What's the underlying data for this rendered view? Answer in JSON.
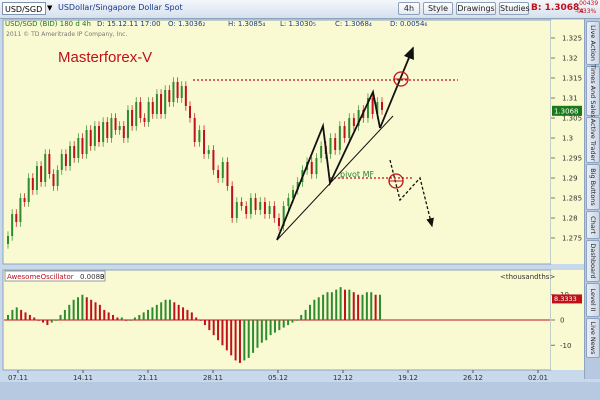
{
  "toolbar": {
    "symbol": "USD/SGD",
    "description": "USDollar/Singapore Dollar Spot",
    "interval": "4h",
    "style_label": "Style",
    "drawings_label": "Drawings",
    "studies_label": "Studies",
    "bid_label": "B: 1.3068",
    "bid_small": "4",
    "change_abs": "-.00439",
    "change_pct": "-0.33%"
  },
  "header": {
    "info_line": "USD/SGD (BID) 180 d 4h",
    "date": "D: 15.12.11 17:00",
    "open": "O: 1.3036₂",
    "high": "H: 1.3085₄",
    "low": "L: 1.3030₅",
    "close": "C: 1.3068₄",
    "change": "D: 0.0054₆",
    "copyright": "2011 © TD Ameritrade IP Company, Inc."
  },
  "annotations": {
    "brand": "Masterforex-V",
    "pivot": "pivot MF"
  },
  "oscillator": {
    "name": "AwesomeOscillator",
    "value": "0.0083",
    "extra": "0",
    "units": "<thousandths>",
    "yticks": [
      "10",
      "0",
      "-10"
    ],
    "current_value_label": "8.3333"
  },
  "right_tabs": [
    "Live Action",
    "Times And Sales",
    "Active Trader",
    "Big Buttons",
    "Chart",
    "Dashboard",
    "Level II",
    "Live News"
  ],
  "colors": {
    "bg_plot": "#fafad2",
    "up": "#2e8b2e",
    "down": "#c0101a",
    "dotted": "#c0101a"
  },
  "chart_data": {
    "type": "candlestick",
    "price": {
      "ylim": [
        1.269,
        1.329
      ],
      "yticks": [
        "1.325",
        "1.32",
        "1.315",
        "1.31",
        "1.305",
        "1.3",
        "1.295",
        "1.29",
        "1.285",
        "1.28",
        "1.275"
      ],
      "last_price_label": "1.3068",
      "resistance": 1.3145,
      "pivot": 1.29,
      "series_close": [
        1.2755,
        1.281,
        1.279,
        1.285,
        1.284,
        1.29,
        1.287,
        1.293,
        1.289,
        1.296,
        1.291,
        1.288,
        1.292,
        1.296,
        1.293,
        1.298,
        1.295,
        1.3,
        1.296,
        1.302,
        1.298,
        1.303,
        1.299,
        1.304,
        1.3,
        1.305,
        1.302,
        1.303,
        1.3,
        1.307,
        1.303,
        1.309,
        1.305,
        1.304,
        1.309,
        1.306,
        1.311,
        1.306,
        1.312,
        1.309,
        1.314,
        1.31,
        1.313,
        1.308,
        1.305,
        1.299,
        1.302,
        1.296,
        1.297,
        1.292,
        1.29,
        1.294,
        1.288,
        1.28,
        1.284,
        1.283,
        1.281,
        1.285,
        1.282,
        1.284,
        1.281,
        1.283,
        1.28,
        1.278,
        1.283,
        1.285,
        1.287,
        1.289,
        1.292,
        1.294,
        1.291,
        1.295,
        1.298,
        1.296,
        1.3,
        1.297,
        1.303,
        1.3,
        1.305,
        1.303,
        1.307,
        1.305,
        1.31,
        1.306,
        1.309,
        1.307
      ]
    },
    "oscillator": {
      "ylim": [
        -19,
        19
      ],
      "values": [
        2,
        4,
        5,
        4,
        3,
        2,
        1,
        0,
        -1,
        -2,
        -1,
        0,
        2,
        4,
        6,
        8,
        9,
        10,
        9,
        8,
        7,
        6,
        4,
        3,
        2,
        1,
        1,
        0,
        0,
        1,
        2,
        3,
        4,
        5,
        6,
        7,
        8,
        8,
        7,
        6,
        5,
        4,
        3,
        1,
        0,
        -2,
        -4,
        -6,
        -8,
        -10,
        -12,
        -14,
        -16,
        -17,
        -16,
        -15,
        -13,
        -11,
        -9,
        -8,
        -6,
        -5,
        -4,
        -3,
        -2,
        -1,
        0,
        2,
        4,
        6,
        8,
        9,
        10,
        11,
        11,
        12,
        13,
        12,
        12,
        11,
        10,
        10,
        11,
        11,
        10,
        10
      ]
    },
    "x_tick_labels": [
      "07.11",
      "14.11",
      "21.11",
      "28.11",
      "05.12",
      "12.12",
      "19.12",
      "26.12",
      "02.01"
    ]
  }
}
